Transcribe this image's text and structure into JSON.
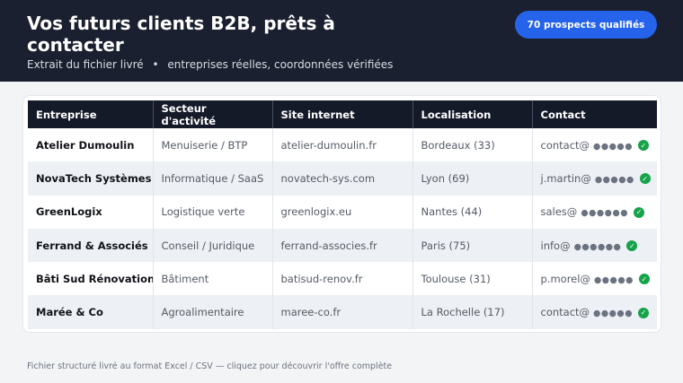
{
  "header": {
    "title": "Vos futurs clients B2B, prêts à contacter",
    "subtitle_left": "Extrait du fichier livré",
    "subtitle_sep": "•",
    "subtitle_right": "entreprises réelles, coordonnées vérifiées",
    "cta_label": "70 prospects qualifiés"
  },
  "table": {
    "columns": [
      "Entreprise",
      "Secteur d'activité",
      "Site internet",
      "Localisation",
      "Contact"
    ],
    "rows": [
      {
        "company": "Atelier Dumoulin",
        "sector": "Menuiserie / BTP",
        "site": "atelier-dumoulin.fr",
        "location": "Bordeaux (33)",
        "contact": "contact@",
        "mask": "●●●●●"
      },
      {
        "company": "NovaTech Systèmes",
        "sector": "Informatique / SaaS",
        "site": "novatech-sys.com",
        "location": "Lyon (69)",
        "contact": "j.martin@",
        "mask": "●●●●●"
      },
      {
        "company": "GreenLogix",
        "sector": "Logistique verte",
        "site": "greenlogix.eu",
        "location": "Nantes (44)",
        "contact": "sales@",
        "mask": "●●●●●●"
      },
      {
        "company": "Ferrand & Associés",
        "sector": "Conseil / Juridique",
        "site": "ferrand-associes.fr",
        "location": "Paris (75)",
        "contact": "info@",
        "mask": "●●●●●●"
      },
      {
        "company": "Bâti Sud Rénovation",
        "sector": "Bâtiment",
        "site": "batisud-renov.fr",
        "location": "Toulouse (31)",
        "contact": "p.morel@",
        "mask": "●●●●●"
      },
      {
        "company": "Marée & Co",
        "sector": "Agroalimentaire",
        "site": "maree-co.fr",
        "location": "La Rochelle (17)",
        "contact": "contact@",
        "mask": "●●●●●"
      }
    ],
    "verified_icon": "check-circle-icon"
  },
  "footer": {
    "text": "Fichier structuré livré au format Excel / CSV — cliquez pour découvrir l'offre complète"
  },
  "colors": {
    "header_bg": "#1b2030",
    "accent": "#2563eb",
    "verified": "#16a34a",
    "table_header_bg": "#151a29"
  }
}
